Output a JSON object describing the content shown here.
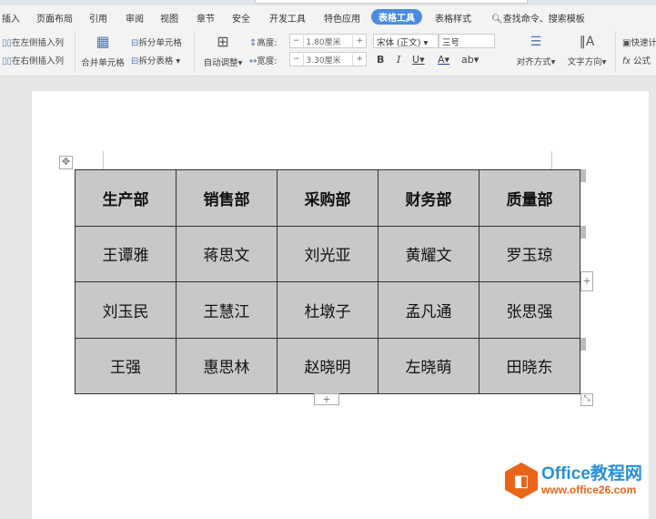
{
  "menu": [
    "插入",
    "页面布局",
    "引用",
    "审阅",
    "视图",
    "章节",
    "安全",
    "开发工具",
    "特色应用",
    "表格工具",
    "表格样式"
  ],
  "search": "查找命令、搜索模板",
  "ribbon": {
    "insert_left_col": "在左侧插入列",
    "insert_right_col": "在右侧插入列",
    "merge_cells": "合并单元格",
    "split_cells": "拆分单元格",
    "split_table": "拆分表格",
    "auto_fit": "自动调整",
    "height_label": "高度:",
    "height_value": "1.80厘米",
    "width_label": "宽度:",
    "width_value": "3.30厘米",
    "font": "宋体 (正文)",
    "size": "三号",
    "bold": "B",
    "italic": "I",
    "underline": "U",
    "font_color": "A",
    "highlight": "ab",
    "align": "对齐方式",
    "text_direction": "文字方向",
    "quick_calc": "快速计",
    "formula": "公式",
    "fx": "fx"
  },
  "table": {
    "header": [
      "生产部",
      "销售部",
      "采购部",
      "财务部",
      "质量部"
    ],
    "rows": [
      [
        "王谭雅",
        "蒋思文",
        "刘光亚",
        "黄耀文",
        "罗玉琼"
      ],
      [
        "刘玉民",
        "王慧江",
        "杜墩子",
        "孟凡通",
        "张思强"
      ],
      [
        "王强",
        "惠思林",
        "赵晓明",
        "左晓萌",
        "田晓东"
      ]
    ],
    "fill": "#c8c8c8"
  },
  "watermark": {
    "title": "Office教程网",
    "url": "www.office26.com"
  }
}
